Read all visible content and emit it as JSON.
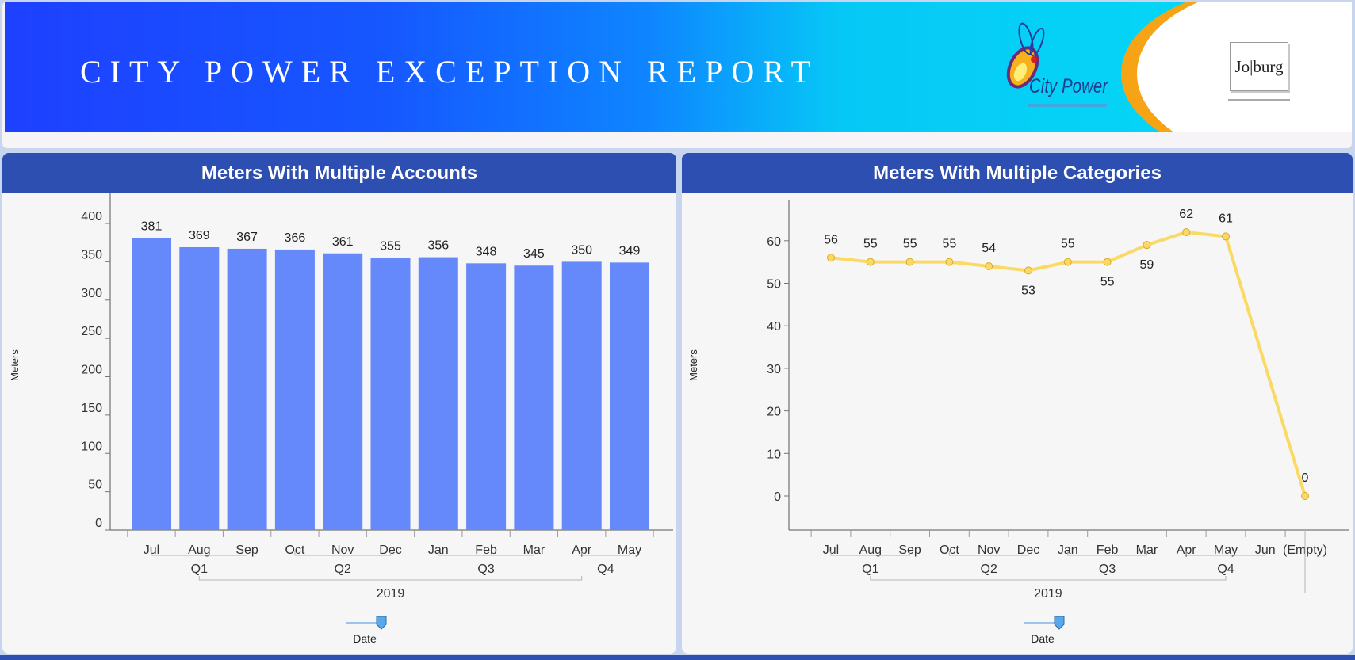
{
  "banner": {
    "title": "CITY POWER EXCEPTION REPORT",
    "logo_text": "City Power",
    "joburg_text": "Jo|burg"
  },
  "colors": {
    "header": "#2e4fb2",
    "bar": "#6588fb",
    "line": "#fbd965",
    "marker_stroke": "#d9a92a"
  },
  "charts": {
    "left": {
      "header": "Meters With Multiple Accounts",
      "slider_label": "Date"
    },
    "right": {
      "header": "Meters With Multiple Categories",
      "slider_label": "Date"
    }
  },
  "chart_data": [
    {
      "type": "bar",
      "title": "Meters With Multiple Accounts",
      "ylabel": "Meters",
      "xlabel": "Date",
      "ylim": [
        0,
        430
      ],
      "yticks": [
        0,
        50,
        100,
        150,
        200,
        250,
        300,
        350,
        400
      ],
      "categories": [
        "Jul",
        "Aug",
        "Sep",
        "Oct",
        "Nov",
        "Dec",
        "Jan",
        "Feb",
        "Mar",
        "Apr",
        "May"
      ],
      "values": [
        381,
        369,
        367,
        366,
        361,
        355,
        356,
        348,
        345,
        350,
        349
      ],
      "quarters": [
        {
          "label": "Q1",
          "from": 0,
          "to": 2
        },
        {
          "label": "Q2",
          "from": 3,
          "to": 5
        },
        {
          "label": "Q3",
          "from": 6,
          "to": 8
        },
        {
          "label": "Q4",
          "from": 9,
          "to": 10
        }
      ],
      "years": [
        {
          "label": "2019",
          "from": 1,
          "to": 9
        }
      ],
      "grid": false
    },
    {
      "type": "line",
      "title": "Meters With Multiple Categories",
      "ylabel": "Meters",
      "xlabel": "Date",
      "ylim": [
        -8,
        68
      ],
      "yticks": [
        0,
        10,
        20,
        30,
        40,
        50,
        60
      ],
      "categories": [
        "Jul",
        "Aug",
        "Sep",
        "Oct",
        "Nov",
        "Dec",
        "Jan",
        "Feb",
        "Mar",
        "Apr",
        "May",
        "Jun",
        "(Empty)"
      ],
      "values": [
        56,
        55,
        55,
        55,
        54,
        53,
        55,
        55,
        59,
        62,
        61,
        null,
        0
      ],
      "label_above": [
        true,
        true,
        true,
        true,
        true,
        false,
        true,
        false,
        false,
        true,
        true,
        true,
        true
      ],
      "quarters": [
        {
          "label": "Q1",
          "from": 0,
          "to": 2
        },
        {
          "label": "Q2",
          "from": 3,
          "to": 5
        },
        {
          "label": "Q3",
          "from": 6,
          "to": 8
        },
        {
          "label": "Q4",
          "from": 9,
          "to": 11
        }
      ],
      "years": [
        {
          "label": "2019",
          "from": 1,
          "to": 10
        }
      ],
      "grid": false
    }
  ]
}
